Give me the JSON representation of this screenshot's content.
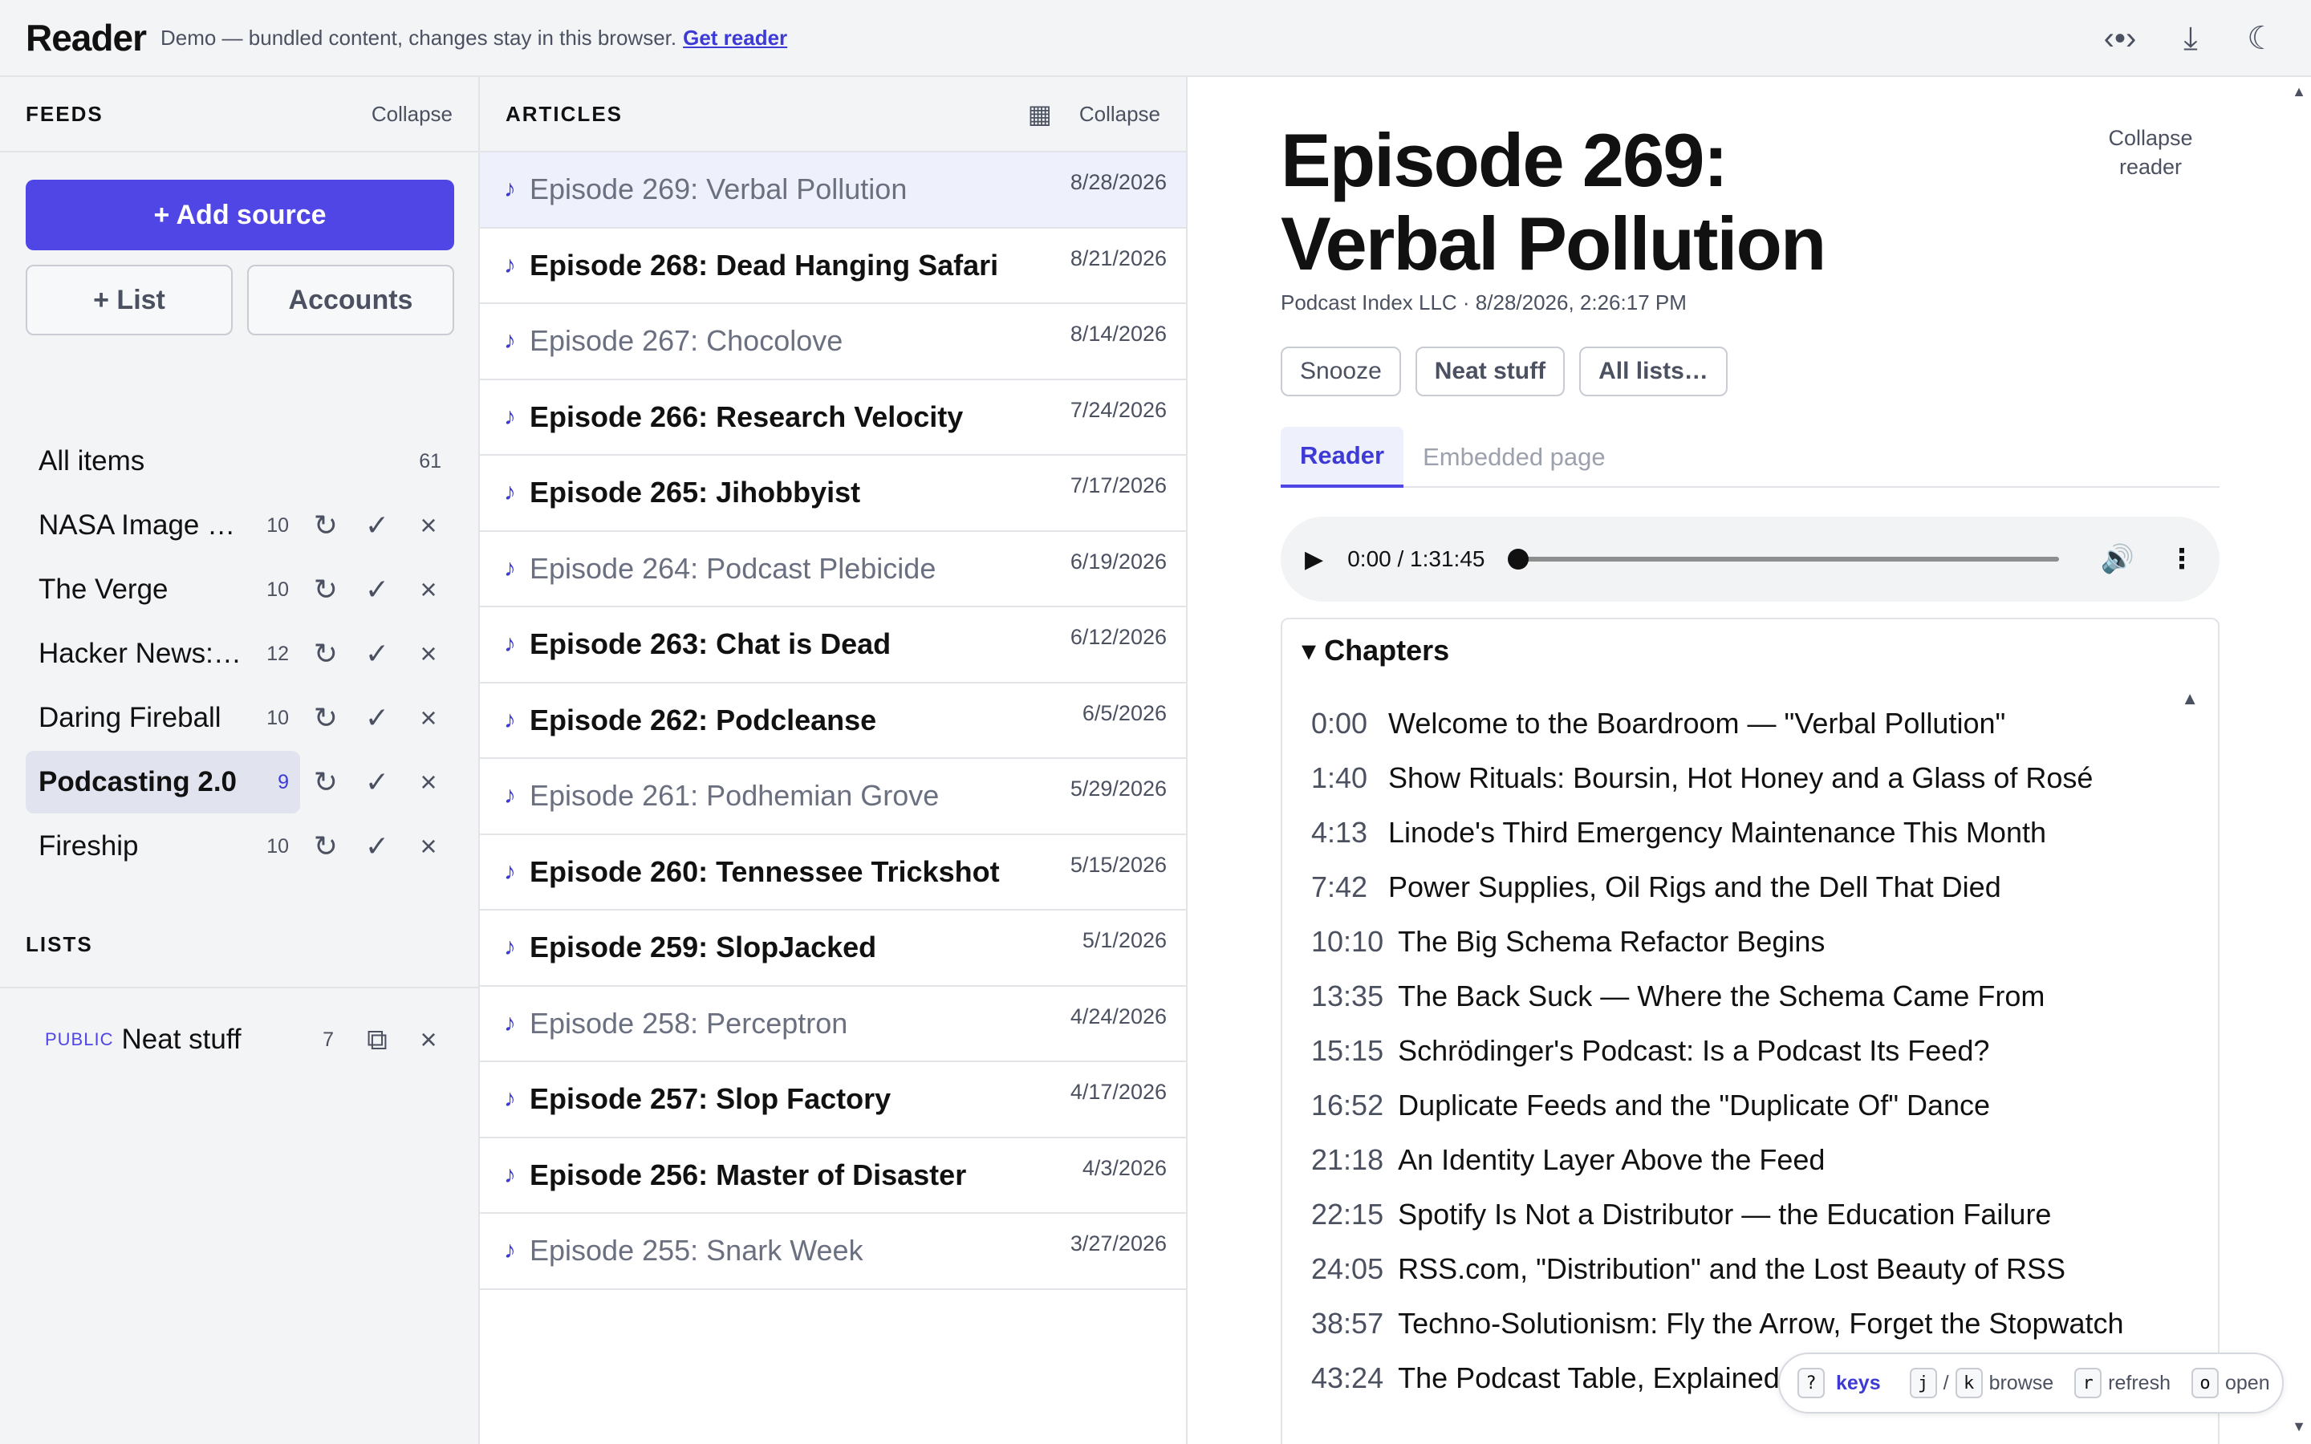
{
  "header": {
    "brand": "Reader",
    "note": "Demo — bundled content, changes stay in this browser.",
    "link": "Get reader",
    "icons": [
      "code-view-icon",
      "download-icon",
      "moon-icon"
    ]
  },
  "feeds_pane": {
    "title": "FEEDS",
    "collapse": "Collapse",
    "add_source": "+ Add source",
    "add_list": "+ List",
    "accounts": "Accounts",
    "all_items": {
      "label": "All items",
      "count": "61"
    },
    "feeds": [
      {
        "name": "NASA Image …",
        "count": "10"
      },
      {
        "name": "The Verge",
        "count": "10"
      },
      {
        "name": "Hacker News:…",
        "count": "12"
      },
      {
        "name": "Daring Fireball",
        "count": "10"
      },
      {
        "name": "Podcasting 2.0",
        "count": "9"
      },
      {
        "name": "Fireship",
        "count": "10"
      }
    ],
    "lists_title": "LISTS",
    "lists": [
      {
        "badge": "PUBLIC",
        "name": "Neat stuff",
        "count": "7"
      }
    ]
  },
  "articles_pane": {
    "title": "ARTICLES",
    "collapse": "Collapse",
    "items": [
      {
        "title": "Episode 269: Verbal Pollution",
        "date": "8/28/2026"
      },
      {
        "title": "Episode 268: Dead Hanging Safari",
        "date": "8/21/2026"
      },
      {
        "title": "Episode 267: Chocolove",
        "date": "8/14/2026"
      },
      {
        "title": "Episode 266: Research Velocity",
        "date": "7/24/2026"
      },
      {
        "title": "Episode 265: Jihobbyist",
        "date": "7/17/2026"
      },
      {
        "title": "Episode 264: Podcast Plebicide",
        "date": "6/19/2026"
      },
      {
        "title": "Episode 263: Chat is Dead",
        "date": "6/12/2026"
      },
      {
        "title": "Episode 262: Podcleanse",
        "date": "6/5/2026"
      },
      {
        "title": "Episode 261: Podhemian Grove",
        "date": "5/29/2026"
      },
      {
        "title": "Episode 260: Tennessee Trickshot",
        "date": "5/15/2026"
      },
      {
        "title": "Episode 259: SlopJacked",
        "date": "5/1/2026"
      },
      {
        "title": "Episode 258: Perceptron",
        "date": "4/24/2026"
      },
      {
        "title": "Episode 257: Slop Factory",
        "date": "4/17/2026"
      },
      {
        "title": "Episode 256: Master of Disaster",
        "date": "4/3/2026"
      },
      {
        "title": "Episode 255: Snark Week",
        "date": "3/27/2026"
      }
    ]
  },
  "reader": {
    "title_line1": "Episode 269:",
    "title_line2": "Verbal Pollution",
    "collapse_line1": "Collapse",
    "collapse_line2": "reader",
    "meta": "Podcast Index LLC · 8/28/2026, 2:26:17 PM",
    "chips": [
      "Snooze",
      "Neat stuff",
      "All lists…"
    ],
    "tabs": [
      "Reader",
      "Embedded page"
    ],
    "audio": {
      "time": "0:00 / 1:31:45",
      "progress": 0
    },
    "chapters_title": "Chapters",
    "chapters": [
      {
        "time": "0:00",
        "title": "Welcome to the Boardroom — \"Verbal Pollution\""
      },
      {
        "time": "1:40",
        "title": "Show Rituals: Boursin, Hot Honey and a Glass of Rosé"
      },
      {
        "time": "4:13",
        "title": "Linode's Third Emergency Maintenance This Month"
      },
      {
        "time": "7:42",
        "title": "Power Supplies, Oil Rigs and the Dell That Died"
      },
      {
        "time": "10:10",
        "title": "The Big Schema Refactor Begins"
      },
      {
        "time": "13:35",
        "title": "The Back Suck — Where the Schema Came From"
      },
      {
        "time": "15:15",
        "title": "Schrödinger's Podcast: Is a Podcast Its Feed?"
      },
      {
        "time": "16:52",
        "title": "Duplicate Feeds and the \"Duplicate Of\" Dance"
      },
      {
        "time": "21:18",
        "title": "An Identity Layer Above the Feed"
      },
      {
        "time": "22:15",
        "title": "Spotify Is Not a Distributor — the Education Failure"
      },
      {
        "time": "24:05",
        "title": "RSS.com, \"Distribution\" and the Lost Beauty of RSS"
      },
      {
        "time": "38:57",
        "title": "Techno-Solutionism: Fly the Arrow, Forget the Stopwatch"
      },
      {
        "time": "43:24",
        "title": "The Podcast Table, Explained"
      }
    ]
  },
  "keys_hint": {
    "help_key": "?",
    "help_label": "keys",
    "browse_key1": "j",
    "browse_sep": "/",
    "browse_key2": "k",
    "browse_label": "browse",
    "refresh_key": "r",
    "refresh_label": "refresh",
    "open_key": "o",
    "open_label": "open"
  }
}
